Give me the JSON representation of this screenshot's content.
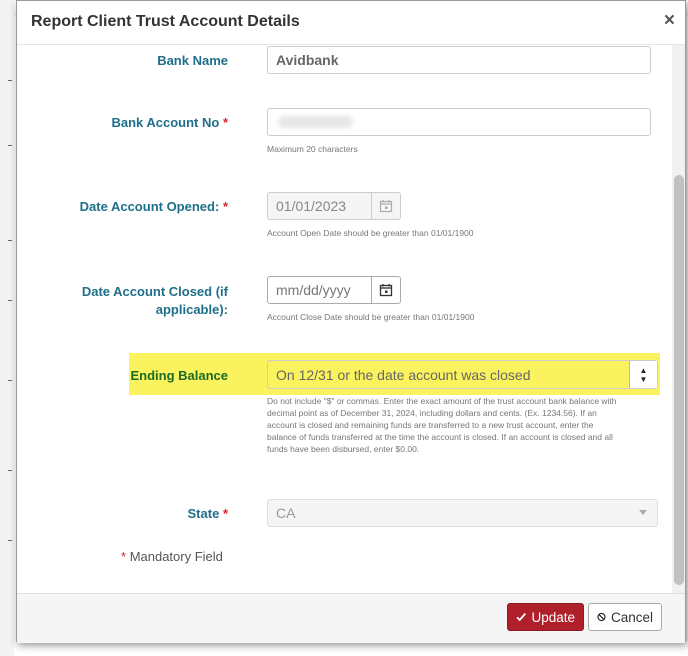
{
  "dialog": {
    "title": "Report Client Trust Account Details",
    "close_icon": "close-icon"
  },
  "fields": {
    "bank_name": {
      "label": "Bank Name",
      "value": "Avidbank"
    },
    "bank_account_no": {
      "label": "Bank Account No",
      "required_mark": "*",
      "value": "",
      "hint": "Maximum 20 characters"
    },
    "date_opened": {
      "label": "Date Account Opened:",
      "required_mark": "*",
      "value": "01/01/2023",
      "hint": "Account Open Date should be greater than 01/01/1900"
    },
    "date_closed": {
      "label_line1": "Date Account Closed (if",
      "label_line2": "applicable):",
      "placeholder": "mm/dd/yyyy",
      "hint": "Account Close Date should be greater than 01/01/1900"
    },
    "ending_balance": {
      "label": "Ending Balance",
      "placeholder": "On 12/31 or the date account was closed",
      "hint_lines": [
        "Do not include \"$\" or commas. Enter the exact amount of the trust account bank balance with",
        "decimal point as of December 31, 2024, including dollars and cents. (Ex. 1234.56). If an",
        "account is closed and remaining funds are transferred to a new trust account, enter the",
        "balance of funds transferred at the time the account is closed. If an account is closed and all",
        "funds have been disbursed, enter $0.00."
      ]
    },
    "state": {
      "label": "State",
      "required_mark": "*",
      "value": "CA"
    }
  },
  "mandatory_note": {
    "mark": "*",
    "text": "Mandatory Field"
  },
  "footer": {
    "update_label": "Update",
    "cancel_label": "Cancel"
  },
  "colors": {
    "label": "#1f6f8b",
    "highlight": "#fbf35d",
    "update_button": "#b0202b",
    "required": "#d9232d"
  }
}
